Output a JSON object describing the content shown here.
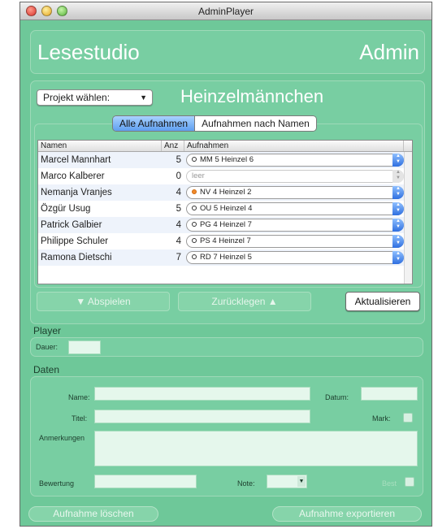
{
  "window": {
    "title": "AdminPlayer"
  },
  "header": {
    "brand": "Lesestudio",
    "role": "Admin"
  },
  "project": {
    "select_label": "Projekt wählen:",
    "title": "Heinzelmännchen"
  },
  "tabs": [
    {
      "label": "Alle Aufnahmen",
      "active": true
    },
    {
      "label": "Aufnahmen nach Namen",
      "active": false
    }
  ],
  "table": {
    "headers": {
      "name": "Namen",
      "anz": "Anz",
      "rec": "Aufnahmen"
    },
    "rows": [
      {
        "name": "Marcel Mannhart",
        "anz": "5",
        "recording": "MM 5 Heinzel 6",
        "dot": "outline",
        "enabled": true
      },
      {
        "name": "Marco Kalberer",
        "anz": "0",
        "recording": "leer",
        "dot": "none",
        "enabled": false
      },
      {
        "name": "Nemanja Vranjes",
        "anz": "4",
        "recording": "NV 4 Heinzel 2",
        "dot": "orange",
        "enabled": true
      },
      {
        "name": "Özgür Usug",
        "anz": "5",
        "recording": "OU 5 Heinzel 4",
        "dot": "outline",
        "enabled": true
      },
      {
        "name": "Patrick Galbier",
        "anz": "4",
        "recording": "PG 4 Heinzel 7",
        "dot": "outline",
        "enabled": true
      },
      {
        "name": "Philippe Schuler",
        "anz": "4",
        "recording": "PS 4 Heinzel 7",
        "dot": "outline",
        "enabled": true
      },
      {
        "name": "Ramona Dietschi",
        "anz": "7",
        "recording": "RD 7 Heinzel 5",
        "dot": "outline",
        "enabled": true
      }
    ]
  },
  "actions": {
    "play": "▼ Abspielen",
    "back": "Zurücklegen ▲",
    "update": "Aktualisieren"
  },
  "player": {
    "section": "Player",
    "duration_label": "Dauer:"
  },
  "daten": {
    "section": "Daten",
    "name_label": "Name:",
    "datum_label": "Datum:",
    "titel_label": "Titel:",
    "mark_label": "Mark:",
    "anmerkungen_label": "Anmerkungen",
    "bewertung_label": "Bewertung",
    "note_label": "Note:",
    "best_label": "Best"
  },
  "footer": {
    "delete": "Aufnahme löschen",
    "export": "Aufnahme exportieren"
  },
  "colors": {
    "window_bg": "#6ec899",
    "accent_selected": "#5f9ff0",
    "recording_dot": "#f08a2a"
  }
}
